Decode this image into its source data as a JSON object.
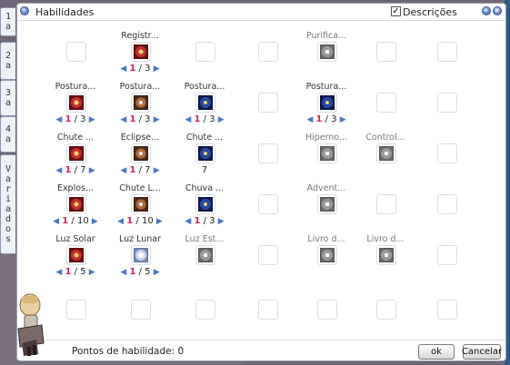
{
  "window": {
    "title": "Habilidades",
    "descriptions_checked": true,
    "descriptions_label": "Descrições",
    "check_mark": "✓"
  },
  "side_tabs": [
    {
      "chars": [
        "1",
        "a"
      ]
    },
    {
      "chars": [
        "2",
        "a"
      ]
    },
    {
      "chars": [
        "3",
        "a"
      ]
    },
    {
      "chars": [
        "4",
        "a"
      ]
    },
    {
      "chars": [
        "V",
        "a",
        "r",
        "i",
        "a",
        "d",
        "o",
        "s"
      ]
    }
  ],
  "skills": {
    "r0": [
      {
        "name": ""
      },
      {
        "name": "Registr...",
        "icon": "registro-icon",
        "icon_class": "g-red",
        "level": "1",
        "max": "3"
      },
      {
        "name": ""
      },
      {
        "name": ""
      },
      {
        "name": "Purifica...",
        "icon": "purificacao-icon",
        "icon_class": "g-gray",
        "gray": true
      },
      {
        "name": ""
      },
      {
        "name": ""
      }
    ],
    "r1": [
      {
        "name": "Postura...",
        "icon": "postura-sol-icon",
        "icon_class": "g-red",
        "level": "1",
        "max": "3"
      },
      {
        "name": "Postura...",
        "icon": "postura-lua-icon",
        "icon_class": "g-brown",
        "level": "1",
        "max": "3"
      },
      {
        "name": "Postura...",
        "icon": "postura-estrela-icon",
        "icon_class": "g-blue",
        "level": "1",
        "max": "3"
      },
      {
        "name": ""
      },
      {
        "name": "Postura...",
        "icon": "postura-universo-icon",
        "icon_class": "g-blue",
        "level": "1",
        "max": "3"
      },
      {
        "name": ""
      },
      {
        "name": ""
      }
    ],
    "r2": [
      {
        "name": "Chute ...",
        "icon": "chute-sol-icon",
        "icon_class": "g-red",
        "level": "1",
        "max": "7"
      },
      {
        "name": "Eclipse...",
        "icon": "eclipse-icon",
        "icon_class": "g-brown",
        "level": "1",
        "max": "7"
      },
      {
        "name": "Chute ...",
        "icon": "chute-estrela-icon",
        "icon_class": "g-blue",
        "level_text": "7"
      },
      {
        "name": ""
      },
      {
        "name": "Hiperno...",
        "icon": "hipernova-icon",
        "icon_class": "g-gray",
        "gray": true
      },
      {
        "name": "Control...",
        "icon": "controle-icon",
        "icon_class": "g-gray",
        "gray": true
      },
      {
        "name": ""
      }
    ],
    "r3": [
      {
        "name": "Explos...",
        "icon": "explosao-icon",
        "icon_class": "g-red",
        "level": "1",
        "max": "10"
      },
      {
        "name": "Chute L...",
        "icon": "chute-lua-icon",
        "icon_class": "g-brown",
        "level": "1",
        "max": "10"
      },
      {
        "name": "Chuva ...",
        "icon": "chuva-estrela-icon",
        "icon_class": "g-blue",
        "level": "1",
        "max": "3"
      },
      {
        "name": ""
      },
      {
        "name": "Advent...",
        "icon": "advento-icon",
        "icon_class": "g-gray",
        "gray": true
      },
      {
        "name": ""
      },
      {
        "name": ""
      }
    ],
    "r4": [
      {
        "name": "Luz Solar",
        "icon": "luz-solar-icon",
        "icon_class": "g-red",
        "level": "1",
        "max": "5"
      },
      {
        "name": "Luz Lunar",
        "icon": "luz-lunar-icon",
        "icon_class": "g-pale",
        "level": "1",
        "max": "5"
      },
      {
        "name": "Luz Est...",
        "icon": "luz-estelar-icon",
        "icon_class": "g-gray",
        "gray": true
      },
      {
        "name": ""
      },
      {
        "name": "Livro d...",
        "icon": "livro-icon",
        "icon_class": "g-gray",
        "gray": true
      },
      {
        "name": "Livro d...",
        "icon": "livro-2-icon",
        "icon_class": "g-gray",
        "gray": true
      },
      {
        "name": ""
      }
    ],
    "r5": [
      {
        "name": ""
      },
      {
        "name": ""
      },
      {
        "name": ""
      },
      {
        "name": ""
      },
      {
        "name": ""
      },
      {
        "name": ""
      },
      {
        "name": ""
      }
    ]
  },
  "footer": {
    "points_label": "Pontos de habilidade: 0",
    "ok_label": "ok",
    "cancel_label": "Cancelar"
  },
  "colors": {
    "level_current": "#d02060",
    "arrow": "#4a78c8",
    "title_button": "#3a5a9e"
  }
}
